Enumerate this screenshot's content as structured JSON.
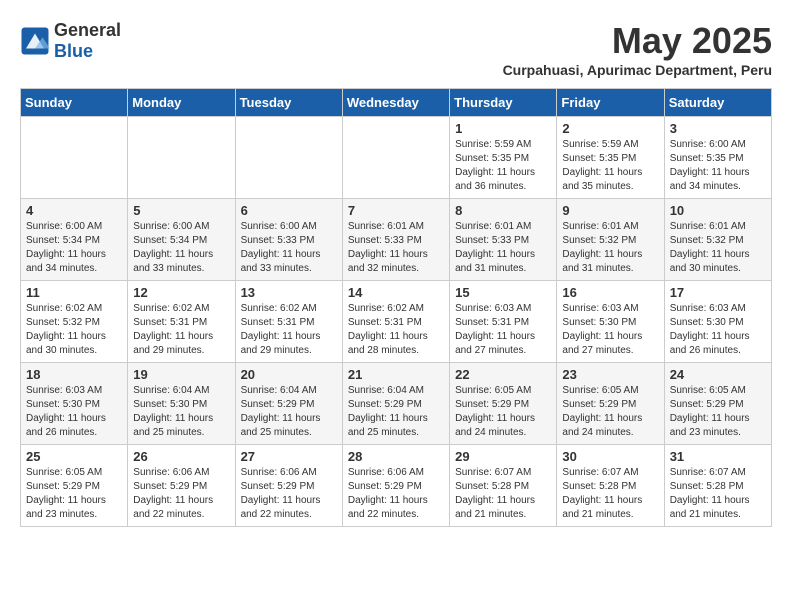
{
  "header": {
    "logo_general": "General",
    "logo_blue": "Blue",
    "month_title": "May 2025",
    "subtitle": "Curpahuasi, Apurimac Department, Peru"
  },
  "days_of_week": [
    "Sunday",
    "Monday",
    "Tuesday",
    "Wednesday",
    "Thursday",
    "Friday",
    "Saturday"
  ],
  "weeks": [
    [
      {
        "day": "",
        "info": ""
      },
      {
        "day": "",
        "info": ""
      },
      {
        "day": "",
        "info": ""
      },
      {
        "day": "",
        "info": ""
      },
      {
        "day": "1",
        "info": "Sunrise: 5:59 AM\nSunset: 5:35 PM\nDaylight: 11 hours\nand 36 minutes."
      },
      {
        "day": "2",
        "info": "Sunrise: 5:59 AM\nSunset: 5:35 PM\nDaylight: 11 hours\nand 35 minutes."
      },
      {
        "day": "3",
        "info": "Sunrise: 6:00 AM\nSunset: 5:35 PM\nDaylight: 11 hours\nand 34 minutes."
      }
    ],
    [
      {
        "day": "4",
        "info": "Sunrise: 6:00 AM\nSunset: 5:34 PM\nDaylight: 11 hours\nand 34 minutes."
      },
      {
        "day": "5",
        "info": "Sunrise: 6:00 AM\nSunset: 5:34 PM\nDaylight: 11 hours\nand 33 minutes."
      },
      {
        "day": "6",
        "info": "Sunrise: 6:00 AM\nSunset: 5:33 PM\nDaylight: 11 hours\nand 33 minutes."
      },
      {
        "day": "7",
        "info": "Sunrise: 6:01 AM\nSunset: 5:33 PM\nDaylight: 11 hours\nand 32 minutes."
      },
      {
        "day": "8",
        "info": "Sunrise: 6:01 AM\nSunset: 5:33 PM\nDaylight: 11 hours\nand 31 minutes."
      },
      {
        "day": "9",
        "info": "Sunrise: 6:01 AM\nSunset: 5:32 PM\nDaylight: 11 hours\nand 31 minutes."
      },
      {
        "day": "10",
        "info": "Sunrise: 6:01 AM\nSunset: 5:32 PM\nDaylight: 11 hours\nand 30 minutes."
      }
    ],
    [
      {
        "day": "11",
        "info": "Sunrise: 6:02 AM\nSunset: 5:32 PM\nDaylight: 11 hours\nand 30 minutes."
      },
      {
        "day": "12",
        "info": "Sunrise: 6:02 AM\nSunset: 5:31 PM\nDaylight: 11 hours\nand 29 minutes."
      },
      {
        "day": "13",
        "info": "Sunrise: 6:02 AM\nSunset: 5:31 PM\nDaylight: 11 hours\nand 29 minutes."
      },
      {
        "day": "14",
        "info": "Sunrise: 6:02 AM\nSunset: 5:31 PM\nDaylight: 11 hours\nand 28 minutes."
      },
      {
        "day": "15",
        "info": "Sunrise: 6:03 AM\nSunset: 5:31 PM\nDaylight: 11 hours\nand 27 minutes."
      },
      {
        "day": "16",
        "info": "Sunrise: 6:03 AM\nSunset: 5:30 PM\nDaylight: 11 hours\nand 27 minutes."
      },
      {
        "day": "17",
        "info": "Sunrise: 6:03 AM\nSunset: 5:30 PM\nDaylight: 11 hours\nand 26 minutes."
      }
    ],
    [
      {
        "day": "18",
        "info": "Sunrise: 6:03 AM\nSunset: 5:30 PM\nDaylight: 11 hours\nand 26 minutes."
      },
      {
        "day": "19",
        "info": "Sunrise: 6:04 AM\nSunset: 5:30 PM\nDaylight: 11 hours\nand 25 minutes."
      },
      {
        "day": "20",
        "info": "Sunrise: 6:04 AM\nSunset: 5:29 PM\nDaylight: 11 hours\nand 25 minutes."
      },
      {
        "day": "21",
        "info": "Sunrise: 6:04 AM\nSunset: 5:29 PM\nDaylight: 11 hours\nand 25 minutes."
      },
      {
        "day": "22",
        "info": "Sunrise: 6:05 AM\nSunset: 5:29 PM\nDaylight: 11 hours\nand 24 minutes."
      },
      {
        "day": "23",
        "info": "Sunrise: 6:05 AM\nSunset: 5:29 PM\nDaylight: 11 hours\nand 24 minutes."
      },
      {
        "day": "24",
        "info": "Sunrise: 6:05 AM\nSunset: 5:29 PM\nDaylight: 11 hours\nand 23 minutes."
      }
    ],
    [
      {
        "day": "25",
        "info": "Sunrise: 6:05 AM\nSunset: 5:29 PM\nDaylight: 11 hours\nand 23 minutes."
      },
      {
        "day": "26",
        "info": "Sunrise: 6:06 AM\nSunset: 5:29 PM\nDaylight: 11 hours\nand 22 minutes."
      },
      {
        "day": "27",
        "info": "Sunrise: 6:06 AM\nSunset: 5:29 PM\nDaylight: 11 hours\nand 22 minutes."
      },
      {
        "day": "28",
        "info": "Sunrise: 6:06 AM\nSunset: 5:29 PM\nDaylight: 11 hours\nand 22 minutes."
      },
      {
        "day": "29",
        "info": "Sunrise: 6:07 AM\nSunset: 5:28 PM\nDaylight: 11 hours\nand 21 minutes."
      },
      {
        "day": "30",
        "info": "Sunrise: 6:07 AM\nSunset: 5:28 PM\nDaylight: 11 hours\nand 21 minutes."
      },
      {
        "day": "31",
        "info": "Sunrise: 6:07 AM\nSunset: 5:28 PM\nDaylight: 11 hours\nand 21 minutes."
      }
    ]
  ]
}
